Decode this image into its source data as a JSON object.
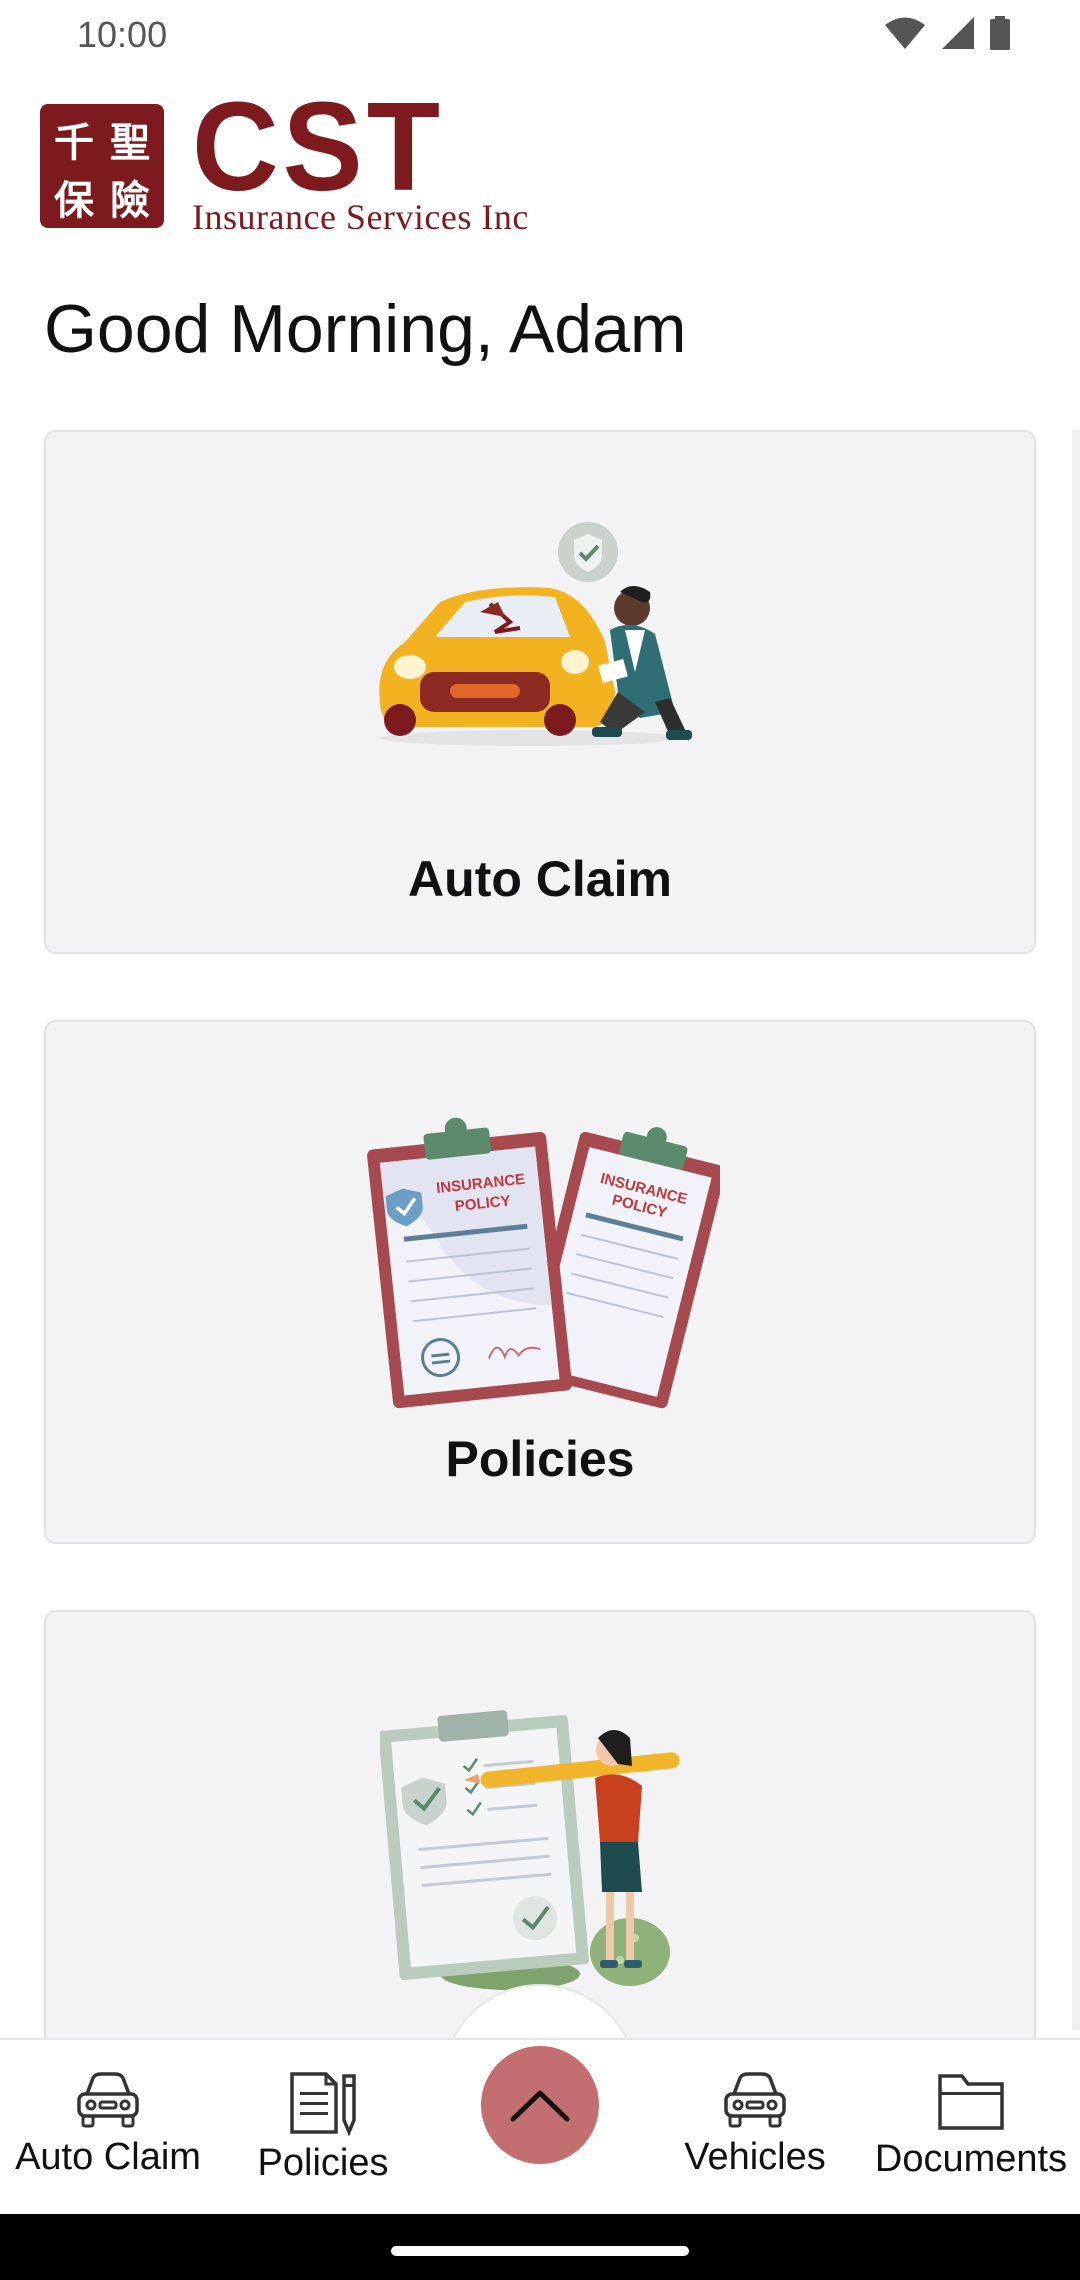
{
  "status_bar": {
    "time": "10:00"
  },
  "logo": {
    "seal_chars": [
      "千",
      "聖",
      "保",
      "險"
    ],
    "brand": "CST",
    "tagline": "Insurance Services Inc",
    "color": "#7d1a1d"
  },
  "greeting": "Good Morning, Adam",
  "cards": [
    {
      "title": "Auto Claim",
      "illustration": "car-damage-inspection"
    },
    {
      "title": "Policies",
      "illustration": "insurance-policy-clipboards"
    },
    {
      "title": "",
      "illustration": "checklist-woman-with-pencil"
    }
  ],
  "policy_illustration": {
    "text_line1": "INSURANCE",
    "text_line2": "POLICY"
  },
  "bottom_nav": {
    "items": [
      {
        "label": "Auto Claim",
        "icon": "car-icon"
      },
      {
        "label": "Policies",
        "icon": "document-pencil-icon"
      },
      {
        "label": "Vehicles",
        "icon": "car-icon"
      },
      {
        "label": "Documents",
        "icon": "folder-icon"
      }
    ],
    "fab_icon": "chevron-up-icon",
    "fab_color": "#c46f6f"
  }
}
